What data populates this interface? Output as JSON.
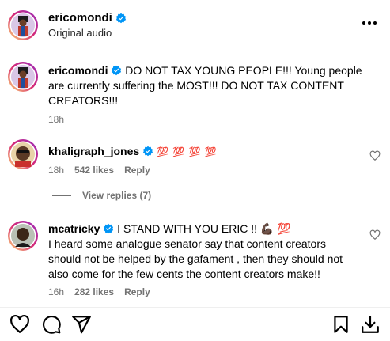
{
  "header": {
    "username": "ericomondi",
    "subtitle": "Original audio"
  },
  "comments": [
    {
      "username": "ericomondi",
      "text": "DO NOT TAX YOUNG PEOPLE!!! Young people are currently suffering the MOST!!! DO NOT TAX CONTENT CREATORS!!!",
      "time": "18h"
    },
    {
      "username": "khaligraph_jones",
      "text": "💯 💯 💯 💯",
      "time": "18h",
      "likes": "542 likes",
      "reply": "Reply",
      "view_replies": "View replies (7)"
    },
    {
      "username": "mcatricky",
      "text_line1": "I STAND WITH YOU ERIC !! 💪🏿 💯",
      "text_rest": "I heard some analogue senator say that content creators should not be helped by the gafament , then they should not also come for the few cents the content creators make!!",
      "time": "16h",
      "likes": "282 likes",
      "reply": "Reply"
    }
  ],
  "colors": {
    "verified": "#0095f6",
    "secondary_text": "#737373",
    "hundred_red": "#e0245e"
  },
  "icons": [
    "more-icon",
    "verified-icon",
    "heart-icon",
    "comment-icon",
    "share-icon",
    "bookmark-icon",
    "download-icon"
  ]
}
